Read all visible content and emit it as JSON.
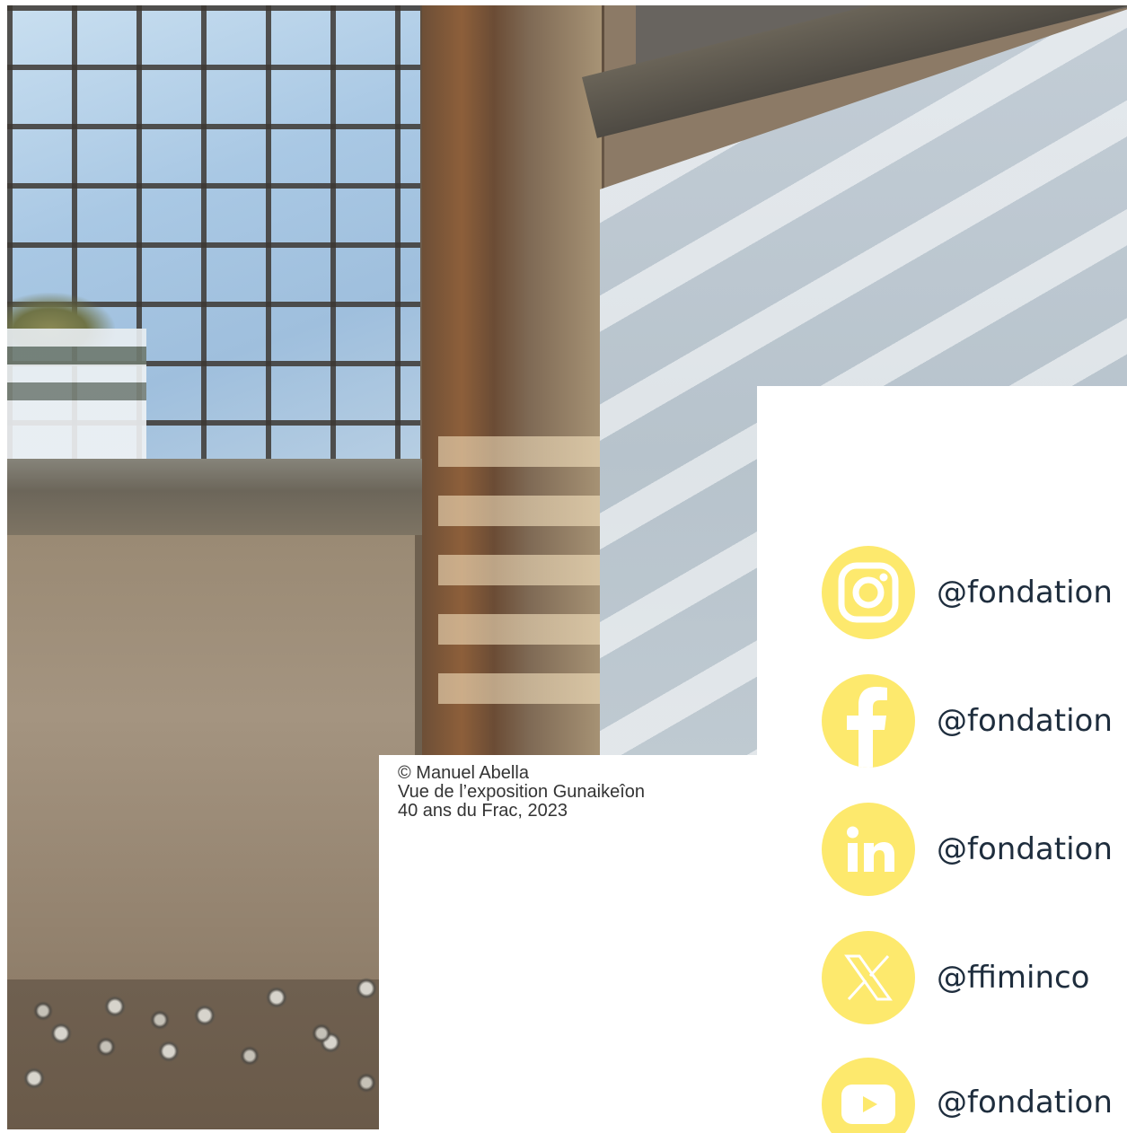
{
  "caption": {
    "line1": "© Manuel Abella",
    "line2": "Vue de l’exposition Gunaikeîon",
    "line3": "40 ans du Frac,  2023"
  },
  "colors": {
    "icon_background": "#fde96d",
    "handle_text": "#1e2d3d",
    "caption_text": "#333333"
  },
  "social": [
    {
      "network": "instagram",
      "icon": "instagram-icon",
      "handle": "@fondation"
    },
    {
      "network": "facebook",
      "icon": "facebook-icon",
      "handle": "@fondation"
    },
    {
      "network": "linkedin",
      "icon": "linkedin-icon",
      "handle": "@fondation"
    },
    {
      "network": "x",
      "icon": "x-icon",
      "handle": "@ffiminco"
    },
    {
      "network": "youtube",
      "icon": "youtube-icon",
      "handle": "@fondation"
    }
  ]
}
